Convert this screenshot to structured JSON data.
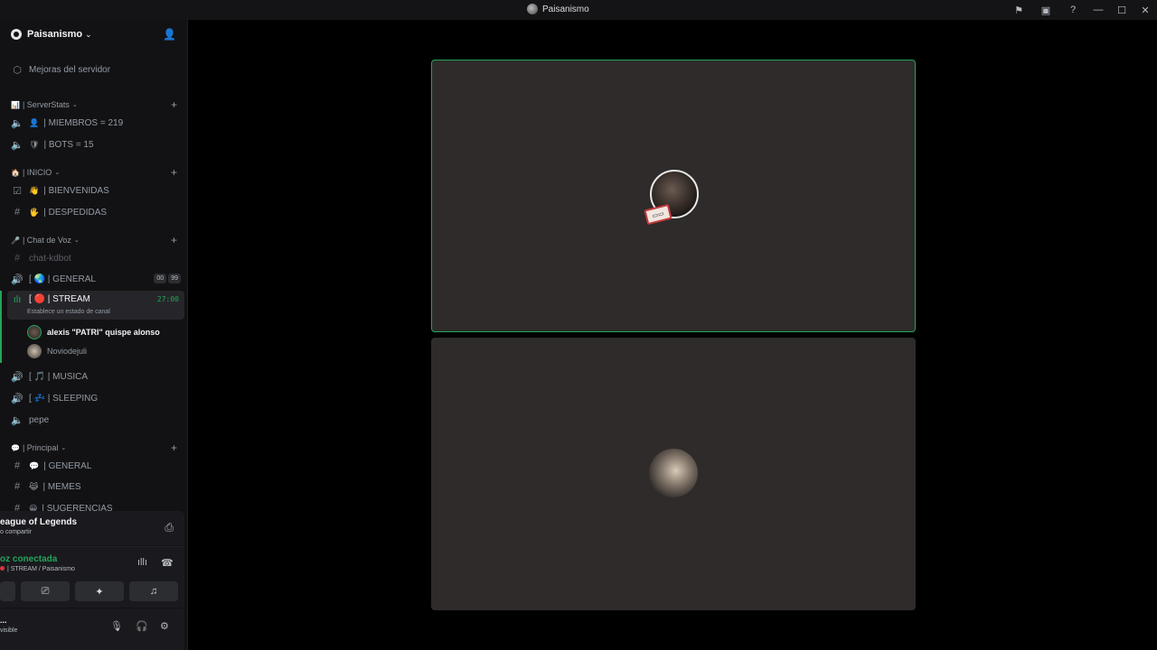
{
  "window": {
    "title": "Paisanismo"
  },
  "titlebar_icons": [
    "flag-icon",
    "inbox-icon",
    "help-icon",
    "minimize-icon",
    "maximize-icon",
    "close-icon"
  ],
  "server": {
    "name": "Paisanismo"
  },
  "sidebar": {
    "top_items": [
      {
        "label": "Mejoras del servidor",
        "icon": "boost-icon"
      }
    ],
    "categories": [
      {
        "name": "| ServerStats",
        "emoji": "📊",
        "channels": [
          {
            "type": "locked-voice",
            "emoji": "👤",
            "label": "| MIEMBROS = 219"
          },
          {
            "type": "locked-voice",
            "emoji": "🛡",
            "label": "| BOTS = 15"
          }
        ]
      },
      {
        "name": "| INICIO",
        "emoji": "🏠",
        "channels": [
          {
            "type": "rules",
            "emoji": "👋",
            "label": "| BIENVENIDAS"
          },
          {
            "type": "text",
            "emoji": "🖐",
            "label": "| DESPEDIDAS"
          }
        ]
      },
      {
        "name": "| Chat de Voz",
        "emoji": "🎤",
        "channels": [
          {
            "type": "text",
            "label": "chat-kdbot"
          },
          {
            "type": "voice",
            "emoji": "🌏",
            "label": "[ 🌏 | GENERAL",
            "badges": [
              "00",
              "99"
            ]
          },
          {
            "type": "voice-active",
            "label": "[ 🔴 | STREAM",
            "timer": "27:00",
            "status": "Establece un estado de canal"
          },
          {
            "type": "voice",
            "label": "[ 🎵 | MUSICA"
          },
          {
            "type": "voice",
            "label": "[ 💤 | SLEEPING"
          },
          {
            "type": "locked-voice",
            "label": "pepe"
          }
        ]
      },
      {
        "name": "| Principal",
        "emoji": "💬",
        "channels": [
          {
            "type": "text",
            "emoji": "💬",
            "label": "| GENERAL"
          },
          {
            "type": "text",
            "emoji": "😹",
            "label": "| MEMES"
          },
          {
            "type": "text",
            "emoji": "😀",
            "label": "| SUGERENCIAS"
          }
        ]
      }
    ],
    "voice_users": [
      {
        "name": "alexis \"PATRI\" quispe alonso",
        "speaking": true
      },
      {
        "name": "Noviodejuli",
        "speaking": false
      }
    ]
  },
  "activity": {
    "title": "eague of Legends",
    "subtitle": "o compartir"
  },
  "voice_panel": {
    "status": "oz conectada",
    "channel": "| STREAM / Paisanismo"
  },
  "user_panel": {
    "name": "...",
    "status": "visible"
  },
  "colors": {
    "accent_green": "#23a55a",
    "tile_bg": "#2e2b2a",
    "sidebar_bg": "#121214"
  }
}
